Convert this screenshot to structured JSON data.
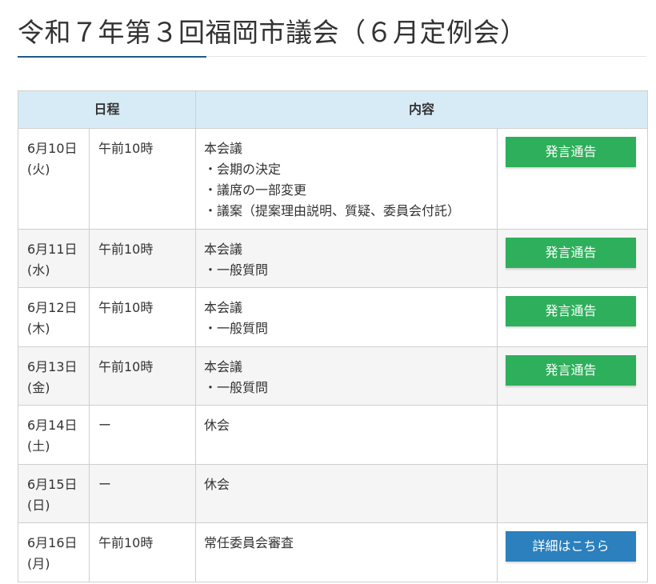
{
  "page": {
    "title": "令和７年第３回福岡市議会（６月定例会）"
  },
  "colors": {
    "header_bg": "#d7ebf6",
    "accent_rule": "#1f5a8a",
    "notice_button": "#2eaf5b",
    "detail_button": "#2b80bd"
  },
  "table": {
    "headers": {
      "schedule": "日程",
      "content": "内容"
    },
    "rows": [
      {
        "date": "6月10日",
        "weekday": "(火)",
        "time": "午前10時",
        "title": "本会議",
        "items": [
          "・会期の決定",
          "・議席の一部変更",
          "・議案（提案理由説明、質疑、委員会付託）"
        ],
        "button": {
          "label": "発言通告",
          "style": "green"
        }
      },
      {
        "date": "6月11日",
        "weekday": "(水)",
        "time": "午前10時",
        "title": "本会議",
        "items": [
          "・一般質問"
        ],
        "button": {
          "label": "発言通告",
          "style": "green"
        }
      },
      {
        "date": "6月12日",
        "weekday": "(木)",
        "time": "午前10時",
        "title": "本会議",
        "items": [
          "・一般質問"
        ],
        "button": {
          "label": "発言通告",
          "style": "green"
        }
      },
      {
        "date": "6月13日",
        "weekday": "(金)",
        "time": "午前10時",
        "title": "本会議",
        "items": [
          "・一般質問"
        ],
        "button": {
          "label": "発言通告",
          "style": "green"
        }
      },
      {
        "date": "6月14日",
        "weekday": "(土)",
        "time": "ー",
        "title": "休会",
        "items": [],
        "button": null
      },
      {
        "date": "6月15日",
        "weekday": "(日)",
        "time": "ー",
        "title": "休会",
        "items": [],
        "button": null
      },
      {
        "date": "6月16日",
        "weekday": "(月)",
        "time": "午前10時",
        "title": "常任委員会審査",
        "items": [],
        "button": {
          "label": "詳細はこちら",
          "style": "blue"
        }
      }
    ]
  }
}
